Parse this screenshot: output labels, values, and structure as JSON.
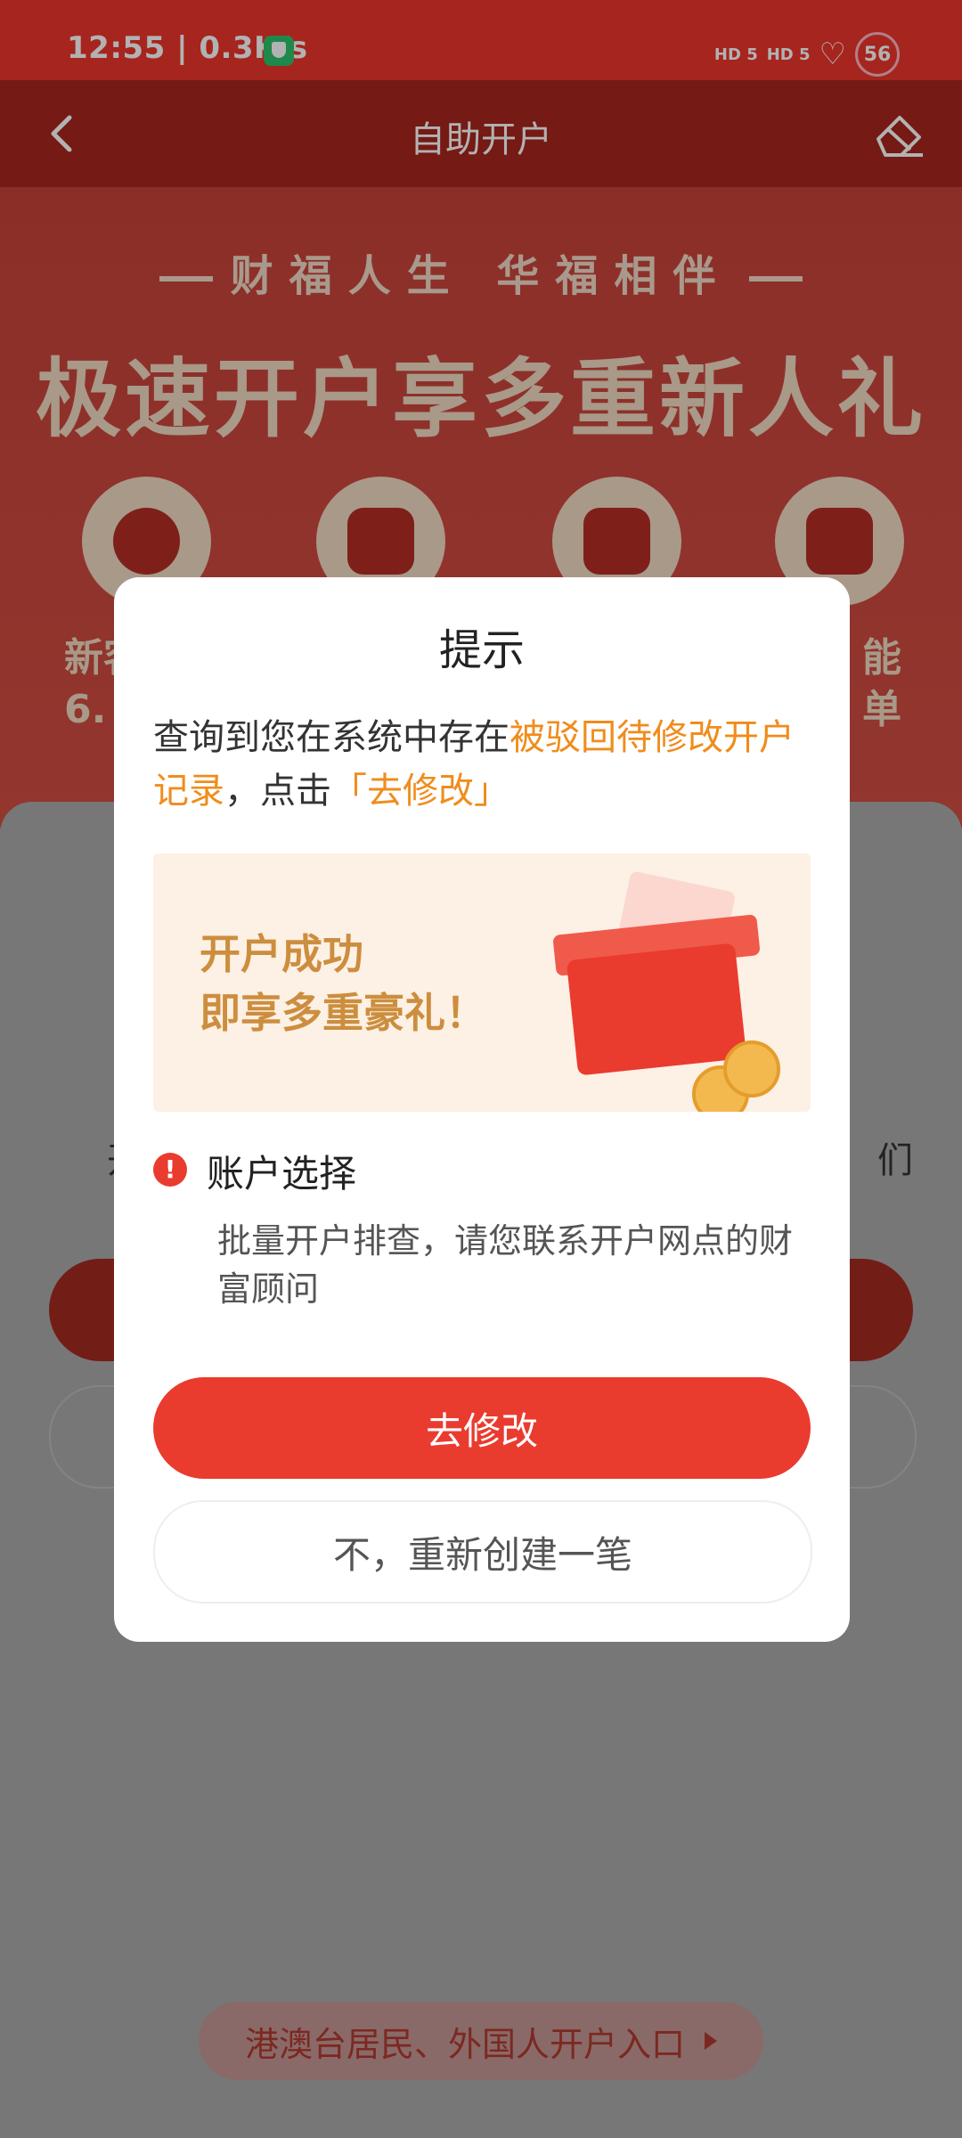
{
  "statusbar": {
    "time": "12:55 | 0.3K/s",
    "signal1": "HD 5",
    "signal2": "HD 5",
    "battery": "56"
  },
  "navbar": {
    "title": "自助开户"
  },
  "hero": {
    "slogan": "财福人生 华福相伴",
    "headline": "极速开户享多重新人礼",
    "benefit_left_label": "新客\n6.",
    "benefit_right_label": "能\n单"
  },
  "background": {
    "text_left": "开",
    "text_right": "们",
    "foreign_entry": "港澳台居民、外国人开户入口"
  },
  "dialog": {
    "title": "提示",
    "message_prefix": "查询到您在系统中存在",
    "message_highlight": "被驳回待修改开户记录",
    "message_middle": "，点击",
    "message_action": "「去修改」",
    "promo_text": "开户成功\n即享多重豪礼！",
    "account_title": "账户选择",
    "account_desc": "批量开户排查，请您联系开户网点的财富顾问",
    "primary_button": "去修改",
    "secondary_button": "不，重新创建一笔"
  },
  "colors": {
    "brand_red": "#ea3b2f",
    "highlight_orange": "#f08c1c",
    "gold": "#cc8e3e"
  }
}
